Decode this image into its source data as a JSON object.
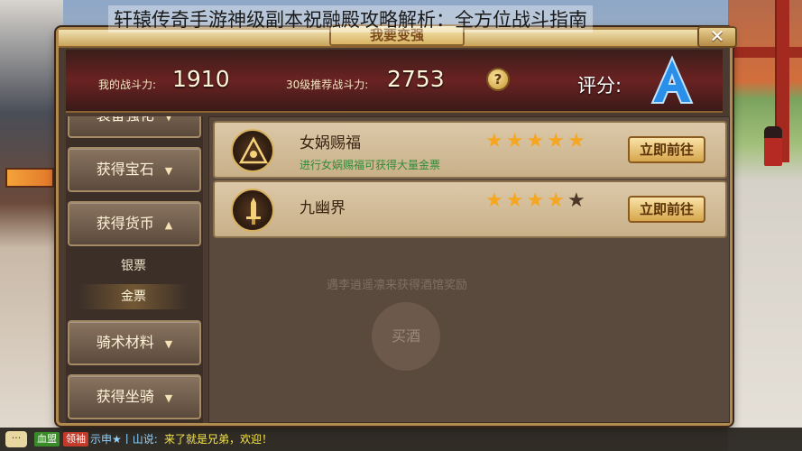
{
  "headline": "轩辕传奇手游神级副本祝融殿攻略解析：全方位战斗指南",
  "panel": {
    "title": "我要变强",
    "close_icon": "close-icon"
  },
  "stats": {
    "my_power_label": "我的战斗力:",
    "my_power_value": "1910",
    "recommended_label": "30级推荐战斗力:",
    "recommended_value": "2753",
    "help_symbol": "?",
    "grade_label": "评分:",
    "grade_value": "A"
  },
  "sidebar": {
    "items": [
      {
        "label": "装备强化",
        "arrow": "▼"
      },
      {
        "label": "获得宝石",
        "arrow": "▼"
      },
      {
        "label": "获得货币",
        "arrow": "▲"
      },
      {
        "label": "骑术材料",
        "arrow": "▼"
      },
      {
        "label": "获得坐骑",
        "arrow": "▼"
      }
    ],
    "sub_items": [
      {
        "label": "银票",
        "active": false
      },
      {
        "label": "金票",
        "active": true
      }
    ]
  },
  "rows": [
    {
      "name": "女娲赐福",
      "desc": "进行女娲赐福可获得大量金票",
      "stars": 5,
      "stars_max": 5,
      "button": "立即前往",
      "icon": "triangle-eye-emblem-icon"
    },
    {
      "name": "九幽界",
      "desc": "",
      "stars": 4,
      "stars_max": 5,
      "button": "立即前往",
      "icon": "sword-emblem-icon"
    }
  ],
  "background_watermark": {
    "circle_text": "买酒",
    "line_text": "遇李逍遥凛来获得酒馆奖励"
  },
  "chat": {
    "icon_text": "···",
    "tag1": "血盟",
    "tag2": "领袖",
    "name": "示申★丨山说:",
    "message": "来了就是兄弟，欢迎！"
  },
  "colors": {
    "panel_bg": "#4a3a30",
    "gold_border": "#b08a4e",
    "star": "#f5a623",
    "desc_green": "#2e8c3a",
    "grade_blue": "#2a8fe8"
  }
}
